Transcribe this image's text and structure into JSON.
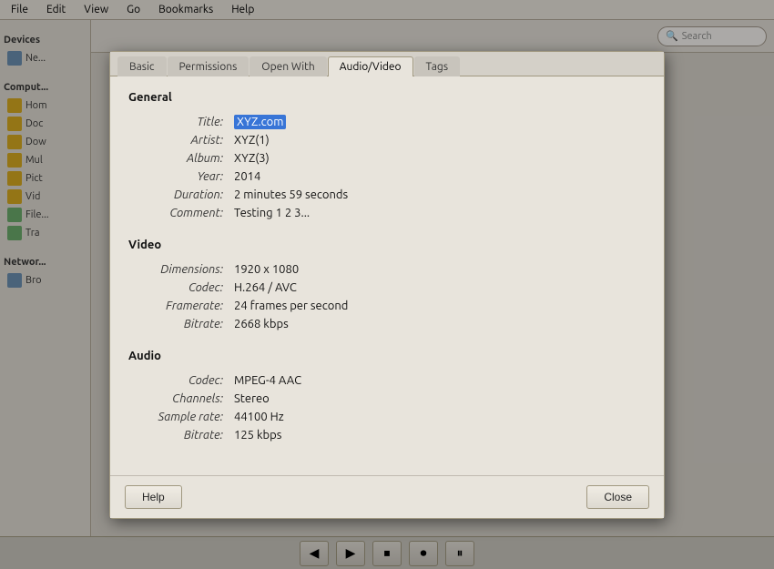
{
  "background": {
    "menubar": [
      "File",
      "Edit",
      "View",
      "Go",
      "Bookmarks",
      "Help"
    ],
    "sidebar": {
      "sections": [
        {
          "title": "Devices",
          "items": [
            {
              "label": "Ne...",
              "icon": "blue2"
            },
            {
              "label": "Hom",
              "icon": "yellow"
            },
            {
              "label": "Doc",
              "icon": "yellow"
            },
            {
              "label": "Dow",
              "icon": "yellow"
            },
            {
              "label": "Mul",
              "icon": "yellow"
            },
            {
              "label": "Pict",
              "icon": "yellow"
            },
            {
              "label": "Vid",
              "icon": "yellow"
            },
            {
              "label": "File",
              "icon": "green"
            },
            {
              "label": "Tra",
              "icon": "green"
            }
          ]
        },
        {
          "title": "Networ",
          "items": [
            {
              "label": "Bro",
              "icon": "blue2"
            }
          ]
        }
      ]
    },
    "search_placeholder": "Search"
  },
  "dialog": {
    "tabs": [
      {
        "label": "Basic",
        "active": false
      },
      {
        "label": "Permissions",
        "active": false
      },
      {
        "label": "Open With",
        "active": false
      },
      {
        "label": "Audio/Video",
        "active": true
      },
      {
        "label": "Tags",
        "active": false
      }
    ],
    "sections": {
      "general": {
        "title": "General",
        "fields": [
          {
            "label": "Title:",
            "value": "XYZ.com",
            "selected": true
          },
          {
            "label": "Artist:",
            "value": "XYZ(1)"
          },
          {
            "label": "Album:",
            "value": "XYZ(3)"
          },
          {
            "label": "Year:",
            "value": "2014"
          },
          {
            "label": "Duration:",
            "value": "2 minutes 59 seconds"
          },
          {
            "label": "Comment:",
            "value": "Testing 1 2 3..."
          }
        ]
      },
      "video": {
        "title": "Video",
        "fields": [
          {
            "label": "Dimensions:",
            "value": "1920 x 1080"
          },
          {
            "label": "Codec:",
            "value": "H.264 / AVC"
          },
          {
            "label": "Framerate:",
            "value": "24 frames per second"
          },
          {
            "label": "Bitrate:",
            "value": "2668 kbps"
          }
        ]
      },
      "audio": {
        "title": "Audio",
        "fields": [
          {
            "label": "Codec:",
            "value": "MPEG-4 AAC"
          },
          {
            "label": "Channels:",
            "value": "Stereo"
          },
          {
            "label": "Sample rate:",
            "value": "44100 Hz"
          },
          {
            "label": "Bitrate:",
            "value": "125 kbps"
          }
        ]
      }
    },
    "footer": {
      "help_label": "Help",
      "close_label": "Close"
    }
  },
  "taskbar": {
    "buttons": [
      "▲",
      "◀",
      "▶",
      "⏺",
      "⏸"
    ]
  }
}
